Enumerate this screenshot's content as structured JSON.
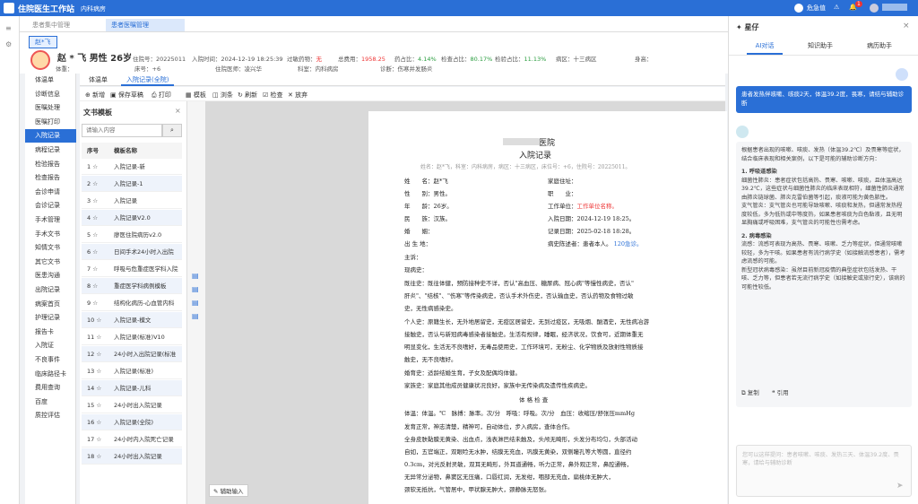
{
  "app": {
    "title": "住院医生工作站",
    "dept": "内科病房",
    "status": "危急值",
    "badge": "1"
  },
  "window_tabs": [
    "患者集中管理",
    "患者医嘱管理"
  ],
  "patient": {
    "tab": "赵*飞",
    "name": "赵 * 飞",
    "gender": "男性",
    "age": "26岁",
    "id_label": "住院号：20225011",
    "admit": "入院时间：2024-12-19 18:25:39",
    "allergy_label": "过敏药物：",
    "allergy": "无",
    "total_label": "总费用：",
    "total": "1958.25",
    "drug_label": "药占比：",
    "drug": "4.14%",
    "exam_label": "检查占比：",
    "exam": "80.17%",
    "test_label": "检验占比：",
    "test": "11.13%",
    "ward": "病区：十三病区",
    "height": "身高：",
    "weight": "体重：",
    "bed": "床号：+6",
    "doctor": "住院医师：凌兴华",
    "dept2": "科室：内科病房",
    "diag": "诊断：伤寒并发肠炎"
  },
  "sidebar": [
    "体温单",
    "诊断信息",
    "医嘱处理",
    "医嘱打印",
    "入院记录",
    "病程记录",
    "检验报告",
    "检查报告",
    "会诊申请",
    "会诊记录",
    "手术管理",
    "手术文书",
    "知情文书",
    "其它文书",
    "医患沟通",
    "出院记录",
    "病案首页",
    "护理记录",
    "报告卡",
    "入院证",
    "不良事件",
    "临床路径卡",
    "费用查询",
    "百度",
    "质控评估"
  ],
  "doc_tabs": [
    "体温单",
    "入院记录(全院)"
  ],
  "toolbar": [
    "新增",
    "保存草稿",
    "打印",
    "模板",
    "浏条",
    "刷新",
    "检查",
    "放弃"
  ],
  "tpl": {
    "title": "文书模板",
    "search_placeholder": "请输入内容",
    "col_no": "序号",
    "col_name": "模板名称",
    "rows": [
      [
        "1",
        "入院记录-新"
      ],
      [
        "2",
        "入院记录-1"
      ],
      [
        "3",
        "入院记录"
      ],
      [
        "4",
        "入院记录V2.0"
      ],
      [
        "5",
        "廖医住院病历v2.0"
      ],
      [
        "6",
        "日间手术24小时入出院"
      ],
      [
        "7",
        "呼吸与危重症医学科入院"
      ],
      [
        "8",
        "重症医学科病例模板"
      ],
      [
        "9",
        "结构化病历-心血管内科"
      ],
      [
        "10",
        "入院记录-模文"
      ],
      [
        "11",
        "入院记录(标准)V10"
      ],
      [
        "12",
        "24小时入出院记录(标准"
      ],
      [
        "13",
        "入院记录(标准)"
      ],
      [
        "14",
        "入院记录-儿科"
      ],
      [
        "15",
        "24小时出入院记录"
      ],
      [
        "16",
        "入院记录(全院)"
      ],
      [
        "17",
        "24小时内入院死亡记录"
      ],
      [
        "18",
        "24小时出入院记录"
      ]
    ]
  },
  "assist_input": "辅助输入",
  "doc": {
    "hospital": "医院",
    "title": "入院记录",
    "meta": "姓名：赵*飞，科室：内科病房，病区：十三病区，床位号：+6，住院号：20225011。",
    "name_l": "姓　　名：",
    "name": "赵*飞",
    "addr_l": "家庭住址：",
    "gender_l": "性　　别：",
    "gender": "男性。",
    "job_l": "职　　业：",
    "age_l": "年　　龄：",
    "age": "26岁。",
    "work_l": "工作单位：",
    "work": "工作单位名称。",
    "eth_l": "民　　族：",
    "eth": "汉族。",
    "admit_l": "入院日期：",
    "admit": "2024-12-19  18:25。",
    "mar_l": "婚　　姻：",
    "rec_l": "记录日期：",
    "rec": "2025-02-18  18:28。",
    "birth_l": "出 生 地：",
    "src_l": "病史陈述者：",
    "src": "患者本人。",
    "rel": "120急诊。",
    "chief": "主诉：",
    "hpi": "现病史：",
    "p1": "既往史：既往体健，预防接种史不详，否认\"高血压、糖尿病、冠心病\"等慢性病史，否认\"",
    "p2": "肝炎\"、\"结核\"、\"伤寒\"等传染病史，否认手术外伤史，否认输血史，否认药物及食物过敏",
    "p3": "史，无性病感染史。",
    "p4": "个人史：原籍生长，无外地居留史，无疫区居留史，无到过疫区，无吸烟、酗酒史，无性病冶游",
    "p5": "接触史，否认与新冠病毒感染者接触史。生活有规律，睡眠，经济状况，饮食可，近期体重无",
    "p6": "明显变化，生活无不良嗜好，无毒品使用史，工作环境可，无粉尘、化学物质及放射性物质接",
    "p7": "触史，无不良嗜好。",
    "p8": "婚育史：适龄结婚生育，子女及配偶均体健。",
    "p9": "家族史：家庭其他成员健康状况良好，家族中无传染病及遗传性疾病史。",
    "exam": "体 格 检 查",
    "p10": "体温：体温。℃　脉搏：脉率。次/分　呼吸：呼吸。次/分　血压：收缩压/舒张压mmHg",
    "p11": "发育正常，神志清楚，精神可，自动体位，步入病房，查体合作。",
    "p12": "全身皮肤黏膜无黄染、出血点，浅表淋巴结未触及，头颅无畸形，头发分布均匀，头部活动",
    "p13": "自如，五官端正，双眼睑无水肿，结膜无充血，巩膜无黄染，双侧瞳孔等大等圆，直径约",
    "p14": "0.3cm，对光反射灵敏，双耳无畸形，外耳道通畅，听力正常，鼻外观正常，鼻腔通畅，",
    "p15": "无异常分泌物，鼻窦区无压痛，口唇红润，无发绀，咽部无充血，扁桃体无肿大，",
    "p16": "颈软无抵抗，气管居中，甲状腺无肿大，颈静脉无怒张。"
  },
  "assist": {
    "title": "星仔",
    "tabs": [
      "AI对话",
      "知识助手",
      "病历助手"
    ],
    "user_msg": "患者发热伴咳嗽、咳痰2天，体温39.2度，畏寒，请结与辅助诊断",
    "reply_intro": "根据患者出现的咳嗽、咳痰、发热（体温39.2℃）及畏寒等症状，结合临床表现和相关案例，以下是可能的辅助诊断方向：",
    "h1": "1. 呼吸道感染",
    "b1": "细菌性肺炎：患者症状包括高热、畏寒、咳嗽、咳痰，且体温高达39.2℃，这些症状与细菌性肺炎的临床表现相符，细菌性肺炎通常由肺炎链球菌、肺炎克雷伯菌等引起，痰液可能为黄色脓性。",
    "b2": "支气管炎：支气管炎也可能导致咳嗽、咳痰和发热，但通常发热程度较低，多为低热或中等度热，如果患者咳痰为白色黏液，且无明显胸痛或呼吸困难，支气管炎的可能性也需考虑。",
    "h2": "2. 病毒感染",
    "b3": "流感：流感可表现为高热、畏寒、咳嗽、乏力等症状，但通常咳嗽较轻，多为干咳。如果患者有流行病学史（如接触流感患者），需考虑流感的可能。",
    "b4": "新型冠状病毒感染：虽然目前新冠疫情的典型症状包括发热、干咳、乏力等，但患者若无流行病学史（如接触史或旅行史），该病的可能性较低。",
    "copy": "复制",
    "quote": "引用",
    "input_placeholder": "您可以这样提问：患者咳嗽、咳痰、发热三天、体温39.2度、畏寒，请给与辅助诊断",
    "send": "发送"
  }
}
